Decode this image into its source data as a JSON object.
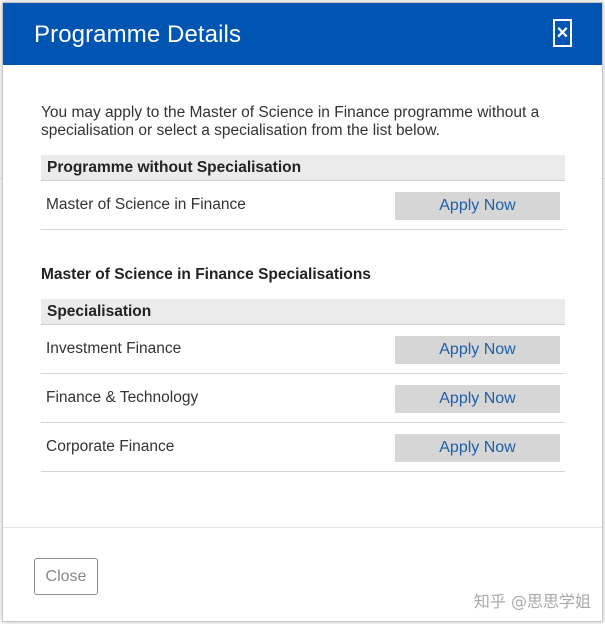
{
  "modal": {
    "title": "Programme Details",
    "close_icon": "×",
    "intro": "You may apply to the Master of Science in Finance programme without a specialisation or select a specialisation from the list below.",
    "without_section": {
      "header": "Programme without Specialisation",
      "rows": [
        {
          "label": "Master of Science in Finance",
          "action": "Apply Now"
        }
      ]
    },
    "specialisations_title": "Master of Science in Finance Specialisations",
    "spec_section": {
      "header": "Specialisation",
      "rows": [
        {
          "label": "Investment Finance",
          "action": "Apply Now"
        },
        {
          "label": "Finance & Technology",
          "action": "Apply Now"
        },
        {
          "label": "Corporate Finance",
          "action": "Apply Now"
        }
      ]
    },
    "footer": {
      "close_label": "Close"
    }
  },
  "watermark": "知乎 @思思学姐",
  "colors": {
    "header_bg": "#0055b3",
    "link_blue": "#1f5fa8",
    "button_bg": "#d6d6d6",
    "section_bg": "#ebebeb"
  }
}
